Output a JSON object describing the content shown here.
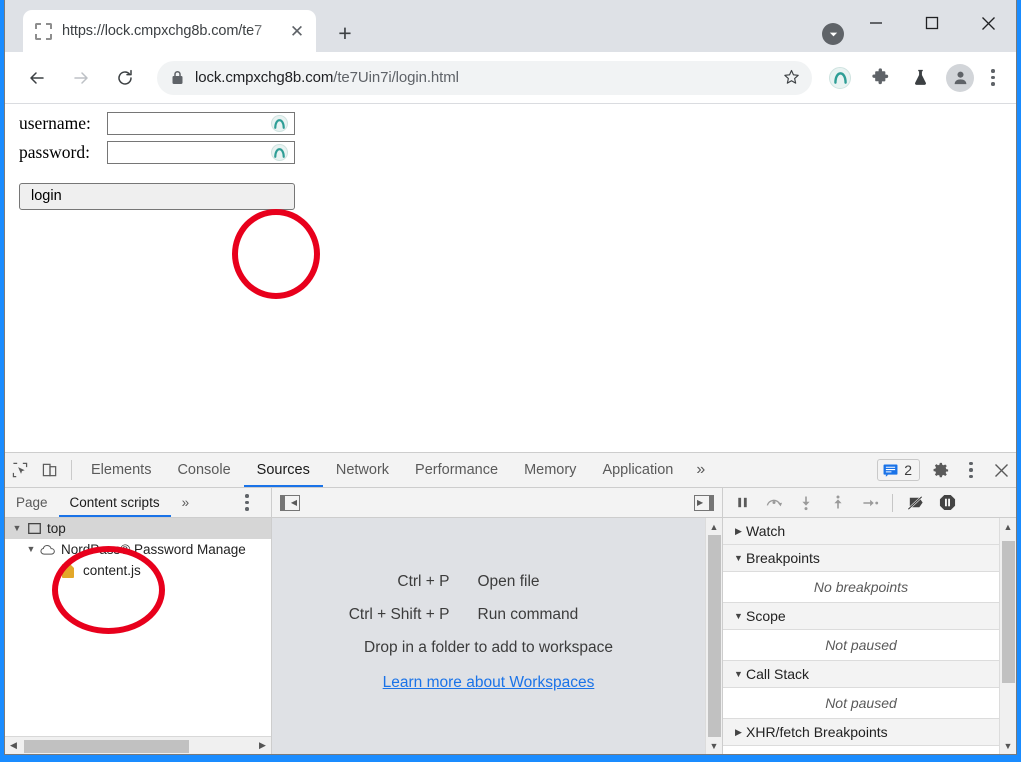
{
  "window": {
    "controls": {
      "minimize": "minimize-button",
      "maximize": "maximize-button",
      "close": "close-button"
    }
  },
  "tabstrip": {
    "tab": {
      "title": "https://lock.cmpxchg8b.com/te7",
      "close_label": "✕",
      "favicon": "missing-favicon-placeholder"
    },
    "new_tab_label": "+",
    "tab_search": "tab-search-button"
  },
  "toolbar": {
    "back": "back-button",
    "forward": "forward-button",
    "reload": "reload-button",
    "url_secure": "lock.cmpxchg8b.com",
    "url_path": "/te7Uin7i/login.html",
    "star": "bookmark-star-icon",
    "extension_nordpass": "nordpass-extension-icon",
    "extensions_puzzle": "extensions-puzzle-icon",
    "experiments_flask": "experiments-flask-icon",
    "profile": "profile-avatar-icon",
    "menu": "chrome-menu-icon"
  },
  "page": {
    "username_label": "username:",
    "password_label": "password:",
    "username_value": "",
    "password_value": "",
    "login_button": "login",
    "nordpass_field_icon": "nordpass-autofill-icon"
  },
  "annotations": {
    "accent_color": "#e8001c",
    "page_ring": "red-highlight-circle-fields",
    "tree_ring": "red-highlight-circle-contentjs"
  },
  "devtools": {
    "inspect_icon": "inspect-element-icon",
    "device_icon": "device-toolbar-icon",
    "tabs": [
      {
        "label": "Elements",
        "active": false
      },
      {
        "label": "Console",
        "active": false
      },
      {
        "label": "Sources",
        "active": true
      },
      {
        "label": "Network",
        "active": false
      },
      {
        "label": "Performance",
        "active": false
      },
      {
        "label": "Memory",
        "active": false
      },
      {
        "label": "Application",
        "active": false
      }
    ],
    "overflow_label": "»",
    "message_count": "2",
    "settings_icon": "settings-gear-icon",
    "more_icon": "devtools-more-icon",
    "close_icon": "devtools-close-icon",
    "navigator": {
      "tabs": [
        {
          "label": "Page",
          "active": false
        },
        {
          "label": "Content scripts",
          "active": true
        }
      ],
      "overflow_label": "»",
      "more_icon": "navigator-more-icon",
      "tree": [
        {
          "label": "top",
          "indent": 0,
          "tri": "▼",
          "icon": "frame-icon",
          "selected": true
        },
        {
          "label": "NordPass® Password Manage",
          "indent": 1,
          "tri": "▼",
          "icon": "cloud-icon",
          "selected": false
        },
        {
          "label": "content.js",
          "indent": 2,
          "tri": "",
          "icon": "file-icon",
          "selected": false
        }
      ]
    },
    "editor": {
      "toggle_navigator": "show-navigator-toggle",
      "toggle_debugger": "show-debugger-toggle",
      "shortcuts": [
        {
          "keys": "Ctrl + P",
          "desc": "Open file"
        },
        {
          "keys": "Ctrl + Shift + P",
          "desc": "Run command"
        }
      ],
      "drop_hint": "Drop in a folder to add to workspace",
      "workspace_link": "Learn more about Workspaces"
    },
    "debugger": {
      "buttons": [
        "pause-script-button",
        "step-over-button",
        "step-into-button",
        "step-out-button",
        "step-button",
        "deactivate-breakpoints-button",
        "pause-on-exceptions-button"
      ],
      "sections": [
        {
          "title": "Watch",
          "tri": "▶",
          "body": null
        },
        {
          "title": "Breakpoints",
          "tri": "▼",
          "body": "No breakpoints"
        },
        {
          "title": "Scope",
          "tri": "▼",
          "body": "Not paused"
        },
        {
          "title": "Call Stack",
          "tri": "▼",
          "body": "Not paused"
        },
        {
          "title": "XHR/fetch Breakpoints",
          "tri": "▶",
          "body": null
        }
      ]
    }
  }
}
